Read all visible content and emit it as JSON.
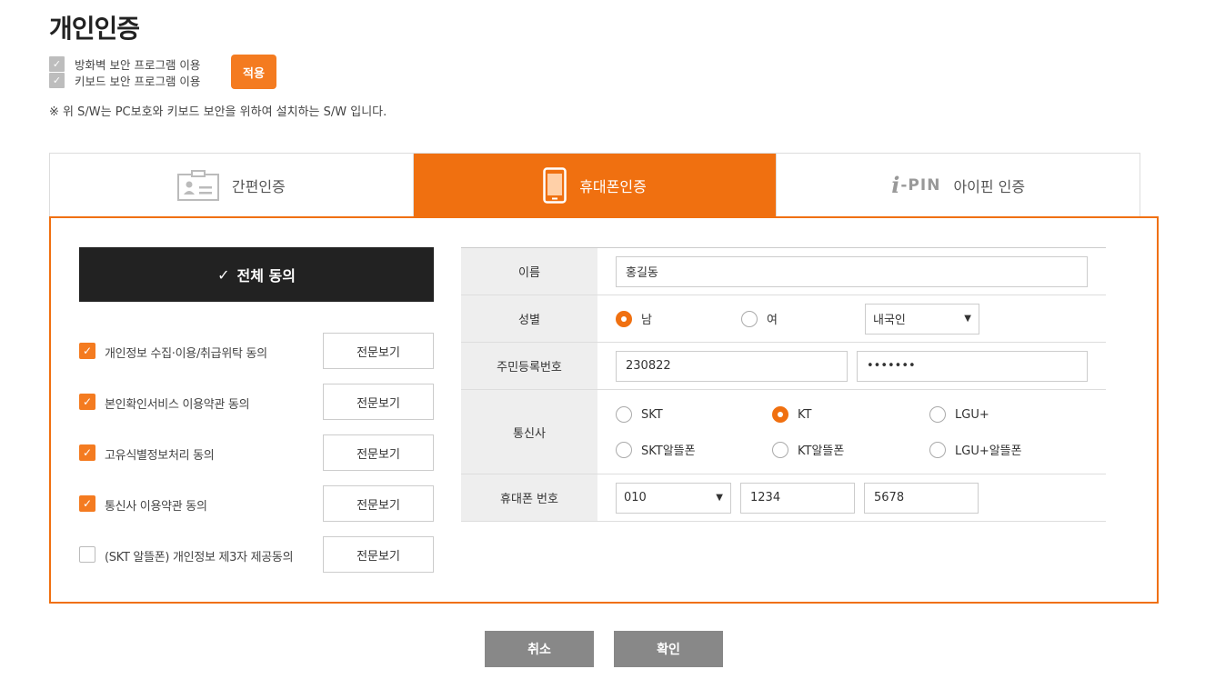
{
  "page": {
    "title": "개인인증"
  },
  "security": {
    "firewall_label": "방화벽 보안 프로그램 이용",
    "keyboard_label": "키보드 보안 프로그램 이용",
    "apply_label": "적용",
    "notice": "※ 위 S/W는 PC보호와 키보드 보안을 위하여 설치하는 S/W 입니다."
  },
  "tabs": [
    {
      "label": "간편인증",
      "icon": "id-card-icon",
      "active": false
    },
    {
      "label": "휴대폰인증",
      "icon": "mobile-phone-icon",
      "active": true
    },
    {
      "label": "아이핀 인증",
      "icon": "ipin-logo-icon",
      "active": false
    }
  ],
  "ipin_logo": {
    "i": "i",
    "pin": "-PIN"
  },
  "agree": {
    "all_label": "전체 동의",
    "view_label": "전문보기",
    "items": [
      {
        "label": "개인정보 수집·이용/취급위탁 동의",
        "checked": true
      },
      {
        "label": "본인확인서비스 이용약관 동의",
        "checked": true
      },
      {
        "label": "고유식별정보처리 동의",
        "checked": true
      },
      {
        "label": "통신사 이용약관 동의",
        "checked": true
      },
      {
        "label": "(SKT 알뜰폰) 개인정보 제3자 제공동의",
        "checked": false
      }
    ]
  },
  "form": {
    "name": {
      "label": "이름",
      "value": "홍길동"
    },
    "gender": {
      "label": "성별",
      "male": "남",
      "female": "여",
      "selected": "남",
      "nationality": "내국인"
    },
    "rrn": {
      "label": "주민등록번호",
      "front": "230822",
      "back": "•••••••"
    },
    "carrier": {
      "label": "통신사",
      "options": [
        "SKT",
        "KT",
        "LGU+",
        "SKT알뜰폰",
        "KT알뜰폰",
        "LGU+알뜰폰"
      ],
      "selected": "KT"
    },
    "phone": {
      "label": "휴대폰 번호",
      "prefix": "010",
      "middle": "1234",
      "last": "5678"
    }
  },
  "buttons": {
    "cancel": "취소",
    "confirm": "확인"
  },
  "colors": {
    "accent": "#f07010",
    "dark": "#222222",
    "gray_button": "#888888"
  }
}
